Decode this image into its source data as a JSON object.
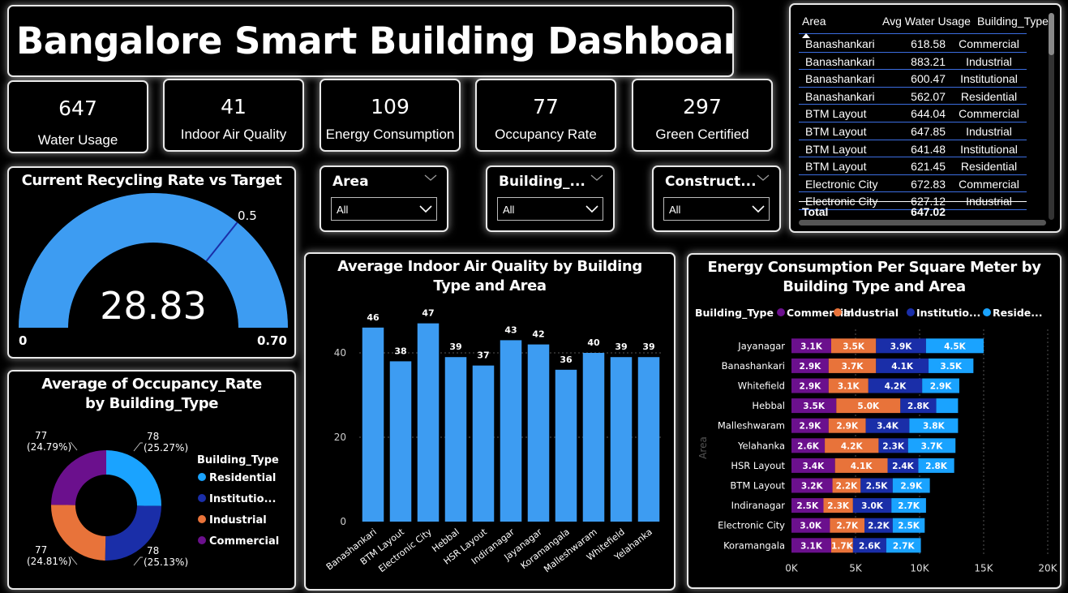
{
  "title": "Bangalore Smart Building Dashboard",
  "kpis": [
    {
      "value": "647",
      "label": "Water Usage"
    },
    {
      "value": "41",
      "label": "Indoor Air Quality"
    },
    {
      "value": "109",
      "label": "Energy Consumption"
    },
    {
      "value": "77",
      "label": "Occupancy Rate"
    },
    {
      "value": "297",
      "label": "Green Certified"
    }
  ],
  "slicers": [
    {
      "title": "Area",
      "value": "All"
    },
    {
      "title": "Building_...",
      "value": "All"
    },
    {
      "title": "Construct...",
      "value": "All"
    }
  ],
  "table": {
    "headers": [
      "Area",
      "Avg Water Usage",
      "Building_Type"
    ],
    "rows": [
      [
        "Banashankari",
        "618.58",
        "Commercial"
      ],
      [
        "Banashankari",
        "883.21",
        "Industrial"
      ],
      [
        "Banashankari",
        "600.47",
        "Institutional"
      ],
      [
        "Banashankari",
        "562.07",
        "Residential"
      ],
      [
        "BTM Layout",
        "644.04",
        "Commercial"
      ],
      [
        "BTM Layout",
        "647.85",
        "Industrial"
      ],
      [
        "BTM Layout",
        "641.48",
        "Institutional"
      ],
      [
        "BTM Layout",
        "621.45",
        "Residential"
      ],
      [
        "Electronic City",
        "672.83",
        "Commercial"
      ],
      [
        "Electronic City",
        "627.12",
        "Industrial"
      ]
    ],
    "total_label": "Total",
    "total_value": "647.02"
  },
  "colors": {
    "residential": "#1aa3ff",
    "institutional": "#1a2ea8",
    "industrial": "#e8733a",
    "commercial": "#6b108d",
    "bar": "#3d9cf2",
    "gauge_fill": "#3d9cf2",
    "gauge_track": "#1c3a63"
  },
  "chart_data": [
    {
      "type": "gauge",
      "title": "Current Recycling Rate vs Target",
      "value": 28.83,
      "value_label": "28.83",
      "min": 0,
      "min_label": "0",
      "max": 0.7,
      "max_label": "0.70",
      "target": 0.5,
      "target_label": "0.5"
    },
    {
      "type": "pie",
      "title": "Average of Occupancy_Rate by Building_Type",
      "legend_title": "Building_Type",
      "legend_position": "right",
      "slices": [
        {
          "name": "Residential",
          "value": 78,
          "value_label": "78",
          "pct_label": "(25.27%)"
        },
        {
          "name": "Institutio...",
          "value": 78,
          "value_label": "78",
          "pct_label": "(25.13%)"
        },
        {
          "name": "Industrial",
          "value": 77,
          "value_label": "77",
          "pct_label": "(24.81%)"
        },
        {
          "name": "Commercial",
          "value": 77,
          "value_label": "77",
          "pct_label": "(24.79%)"
        }
      ]
    },
    {
      "type": "bar",
      "title": "Average Indoor Air Quality by Building Type and Area",
      "categories": [
        "Banashankari",
        "BTM Layout",
        "Electronic City",
        "Hebbal",
        "HSR Layout",
        "Indiranagar",
        "Jayanagar",
        "Koramangala",
        "Malleshwaram",
        "Whitefield",
        "Yelahanka"
      ],
      "values": [
        46,
        38,
        47,
        39,
        37,
        43,
        42,
        36,
        40,
        39,
        39
      ],
      "ylim": [
        0,
        50
      ],
      "yticks": [
        "0",
        "20",
        "40"
      ],
      "grid": true
    },
    {
      "type": "bar",
      "orientation": "horizontal-stacked",
      "title": "Energy Consumption Per Square Meter by Building Type and Area",
      "legend_title": "Building_Type",
      "legend_position": "top",
      "ylabel": "Area",
      "xlim": [
        0,
        20000
      ],
      "xticks": [
        "0K",
        "5K",
        "10K",
        "15K",
        "20K"
      ],
      "categories": [
        "Jayanagar",
        "Banashankari",
        "Whitefield",
        "Hebbal",
        "Malleshwaram",
        "Yelahanka",
        "HSR Layout",
        "BTM Layout",
        "Indiranagar",
        "Electronic City",
        "Koramangala"
      ],
      "series": [
        {
          "name": "Commercial",
          "values": [
            3100,
            2900,
            2900,
            3500,
            2900,
            2600,
            3400,
            3200,
            2500,
            3000,
            3100
          ],
          "labels": [
            "3.1K",
            "2.9K",
            "2.9K",
            "3.5K",
            "2.9K",
            "2.6K",
            "3.4K",
            "3.2K",
            "2.5K",
            "3.0K",
            "3.1K"
          ]
        },
        {
          "name": "Industrial",
          "values": [
            3500,
            3700,
            3100,
            5000,
            2900,
            4200,
            4100,
            2200,
            2300,
            2700,
            1700
          ],
          "labels": [
            "3.5K",
            "3.7K",
            "3.1K",
            "5.0K",
            "2.9K",
            "4.2K",
            "4.1K",
            "2.2K",
            "2.3K",
            "2.7K",
            "1.7K"
          ]
        },
        {
          "name": "Institutio...",
          "values": [
            3900,
            4100,
            4200,
            2800,
            3400,
            2300,
            2400,
            2500,
            3000,
            2200,
            2600
          ],
          "labels": [
            "3.9K",
            "4.1K",
            "4.2K",
            "2.8K",
            "3.4K",
            "2.3K",
            "2.4K",
            "2.5K",
            "3.0K",
            "2.2K",
            "2.6K"
          ]
        },
        {
          "name": "Reside...",
          "values": [
            4500,
            3500,
            2900,
            1700,
            3800,
            3700,
            2800,
            2900,
            2700,
            2500,
            2700
          ],
          "labels": [
            "4.5K",
            "3.5K",
            "2.9K",
            "",
            "3.8K",
            "3.7K",
            "2.8K",
            "2.9K",
            "2.7K",
            "2.5K",
            "2.7K"
          ]
        }
      ]
    }
  ]
}
